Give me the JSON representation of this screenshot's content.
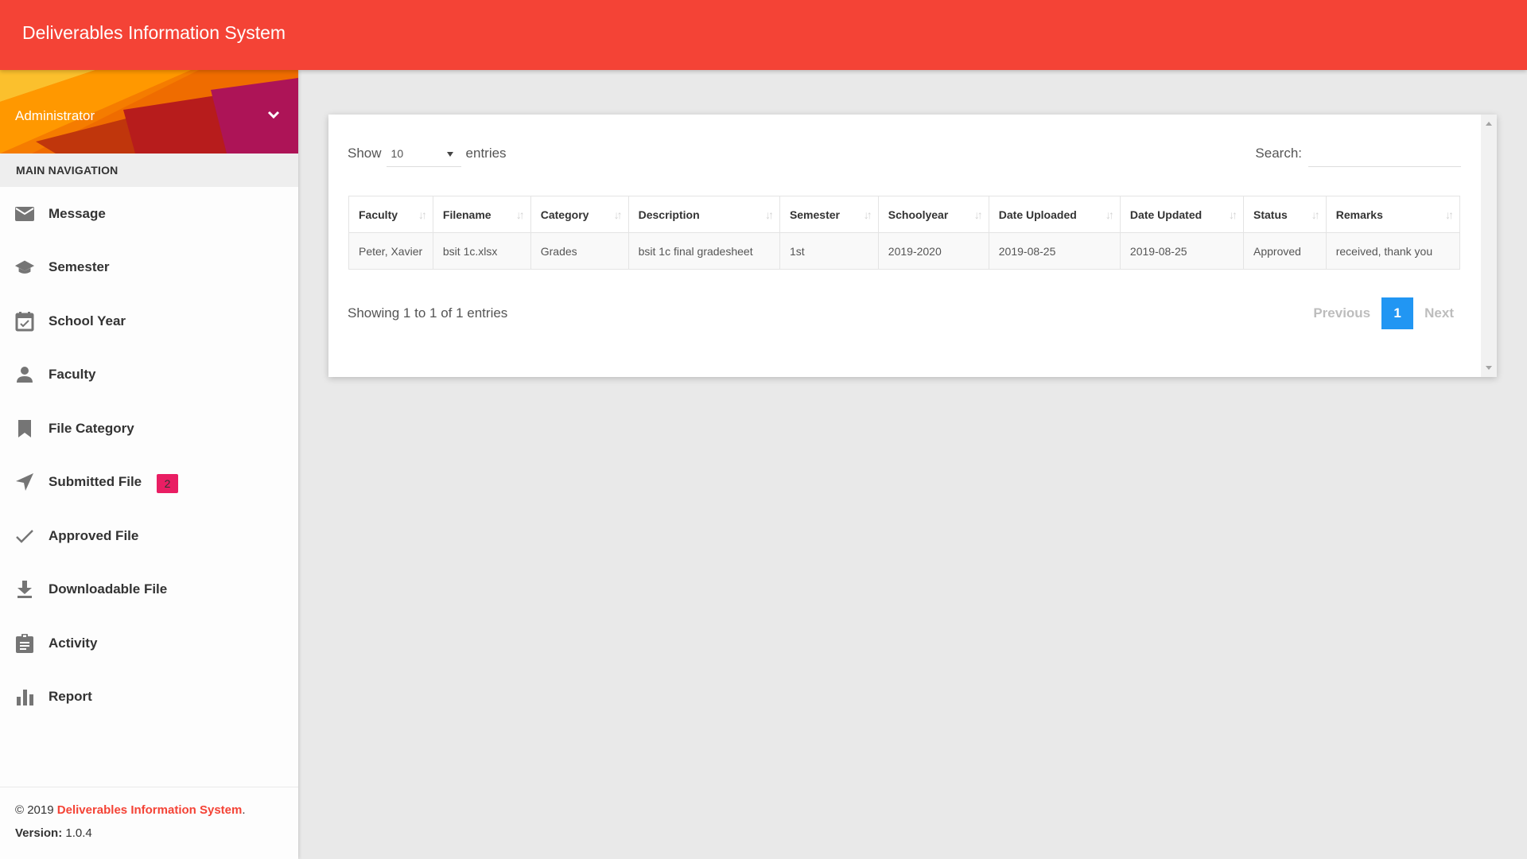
{
  "app": {
    "title": "Deliverables Information System",
    "accent_color": "#F44336"
  },
  "sidebar": {
    "user": {
      "name": "Administrator",
      "menu_icon": "chevron-down-icon"
    },
    "nav_header": "MAIN NAVIGATION",
    "items": [
      {
        "label": "Message",
        "icon": "mail-icon"
      },
      {
        "label": "Semester",
        "icon": "graduation-cap-icon"
      },
      {
        "label": "School Year",
        "icon": "calendar-check-icon"
      },
      {
        "label": "Faculty",
        "icon": "person-icon"
      },
      {
        "label": "File Category",
        "icon": "bookmark-icon"
      },
      {
        "label": "Submitted File",
        "icon": "send-icon",
        "badge": "2",
        "badge_color": "#E91E63"
      },
      {
        "label": "Approved File",
        "icon": "check-icon"
      },
      {
        "label": "Downloadable File",
        "icon": "download-icon"
      },
      {
        "label": "Activity",
        "icon": "clipboard-icon"
      },
      {
        "label": "Report",
        "icon": "bar-chart-icon"
      }
    ],
    "footer": {
      "copyright_prefix": "© 2019",
      "copyright_link": "Deliverables Information System",
      "copyright_suffix": ".",
      "version_label": "Version:",
      "version_value": "1.0.4"
    }
  },
  "datatable": {
    "length": {
      "show_label": "Show",
      "selected": "10",
      "entries_label": "entries"
    },
    "search": {
      "label": "Search:",
      "value": "",
      "placeholder": ""
    },
    "columns": [
      "Faculty",
      "Filename",
      "Category",
      "Description",
      "Semester",
      "Schoolyear",
      "Date Uploaded",
      "Date Updated",
      "Status",
      "Remarks"
    ],
    "rows": [
      [
        "Peter, Xavier",
        "bsit 1c.xlsx",
        "Grades",
        "bsit 1c final gradesheet",
        "1st",
        "2019-2020",
        "2019-08-25",
        "2019-08-25",
        "Approved",
        "received, thank you"
      ]
    ],
    "info": "Showing 1 to 1 of 1 entries",
    "pagination": {
      "previous": "Previous",
      "current_page": "1",
      "next": "Next",
      "active_color": "#2196F3"
    }
  }
}
